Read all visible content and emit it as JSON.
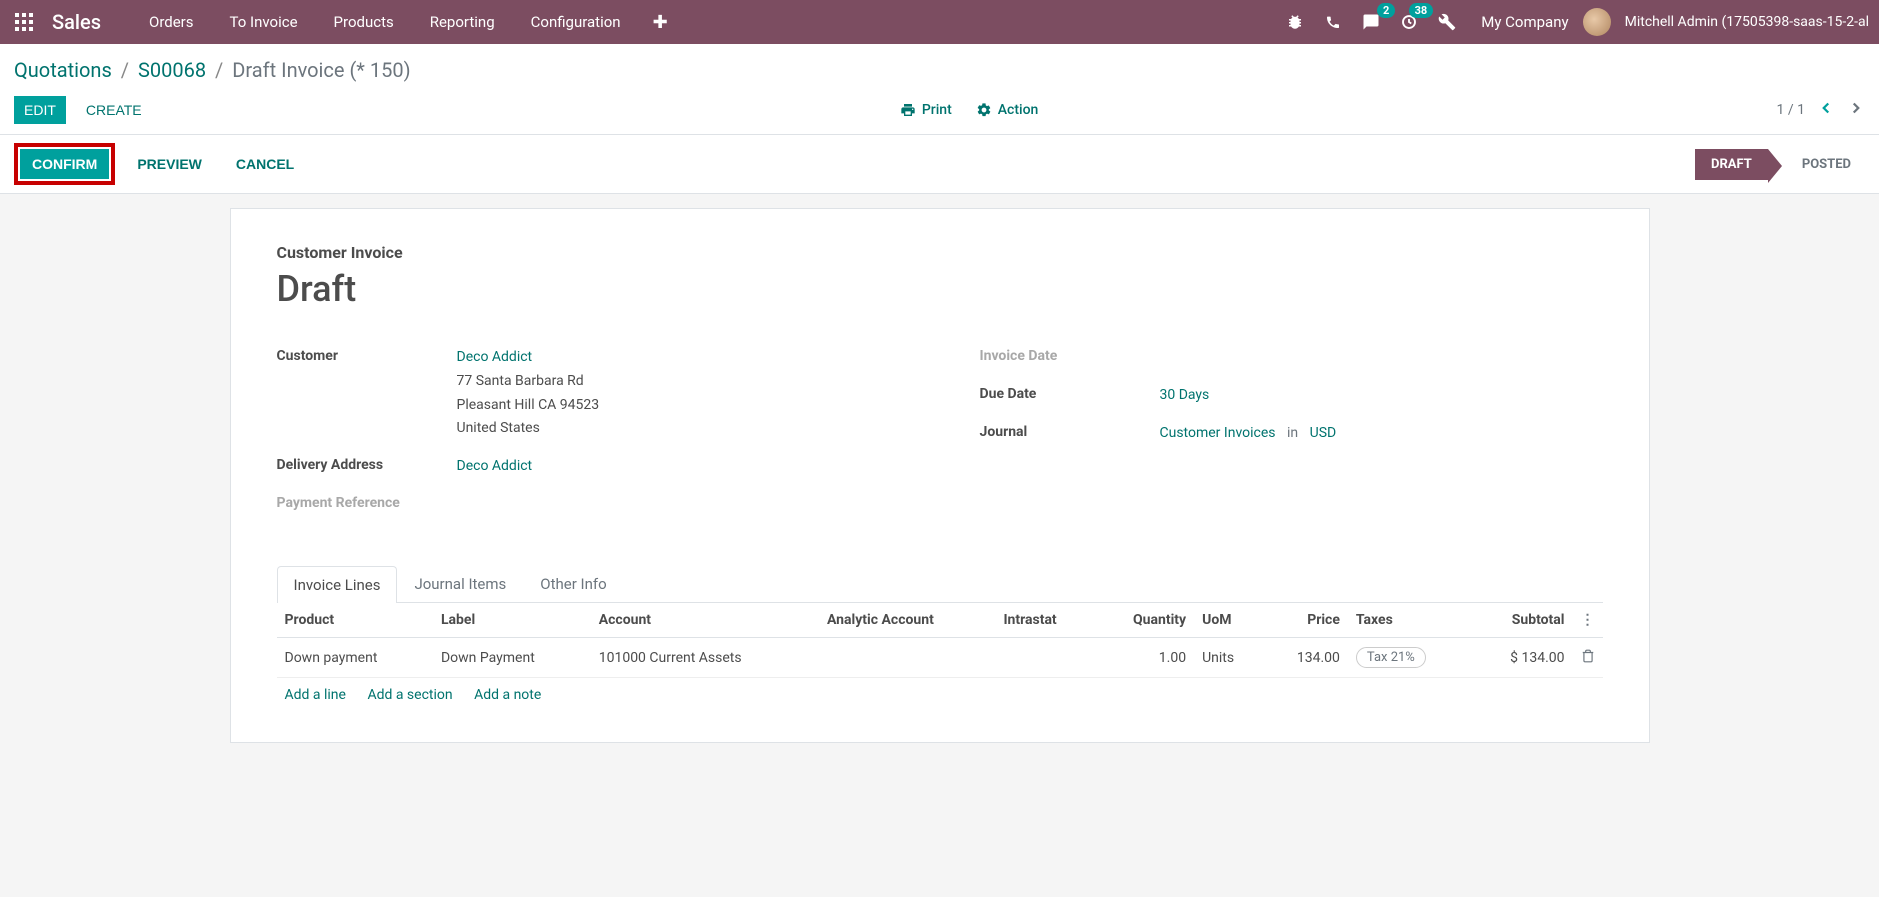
{
  "nav": {
    "brand": "Sales",
    "links": [
      "Orders",
      "To Invoice",
      "Products",
      "Reporting",
      "Configuration"
    ],
    "messages_badge": "2",
    "activities_badge": "38",
    "company": "My Company",
    "user": "Mitchell Admin (17505398-saas-15-2-al"
  },
  "breadcrumb": {
    "items": [
      "Quotations",
      "S00068"
    ],
    "current": "Draft Invoice (* 150)"
  },
  "cp": {
    "edit": "Edit",
    "create": "Create",
    "print": "Print",
    "action": "Action",
    "pager": "1 / 1"
  },
  "statusbar": {
    "confirm": "Confirm",
    "preview": "Preview",
    "cancel": "Cancel",
    "draft": "DRAFT",
    "posted": "POSTED"
  },
  "form": {
    "move_type": "Customer Invoice",
    "status": "Draft",
    "customer_label": "Customer",
    "customer_name": "Deco Addict",
    "address_line1": "77 Santa Barbara Rd",
    "address_line2": "Pleasant Hill CA 94523",
    "address_country": "United States",
    "delivery_label": "Delivery Address",
    "delivery_value": "Deco Addict",
    "payment_ref_label": "Payment Reference",
    "invoice_date_label": "Invoice Date",
    "due_date_label": "Due Date",
    "due_date_value": "30 Days",
    "journal_label": "Journal",
    "journal_value": "Customer Invoices",
    "journal_in": "in",
    "journal_currency": "USD"
  },
  "tabs": {
    "invoice_lines": "Invoice Lines",
    "journal_items": "Journal Items",
    "other_info": "Other Info"
  },
  "table": {
    "headers": {
      "product": "Product",
      "label": "Label",
      "account": "Account",
      "analytic": "Analytic Account",
      "intrastat": "Intrastat",
      "quantity": "Quantity",
      "uom": "UoM",
      "price": "Price",
      "taxes": "Taxes",
      "subtotal": "Subtotal"
    },
    "rows": [
      {
        "product": "Down payment",
        "label": "Down Payment",
        "account": "101000 Current Assets",
        "analytic": "",
        "intrastat": "",
        "quantity": "1.00",
        "uom": "Units",
        "price": "134.00",
        "taxes": "Tax 21%",
        "subtotal": "$ 134.00"
      }
    ],
    "add_line": "Add a line",
    "add_section": "Add a section",
    "add_note": "Add a note"
  }
}
